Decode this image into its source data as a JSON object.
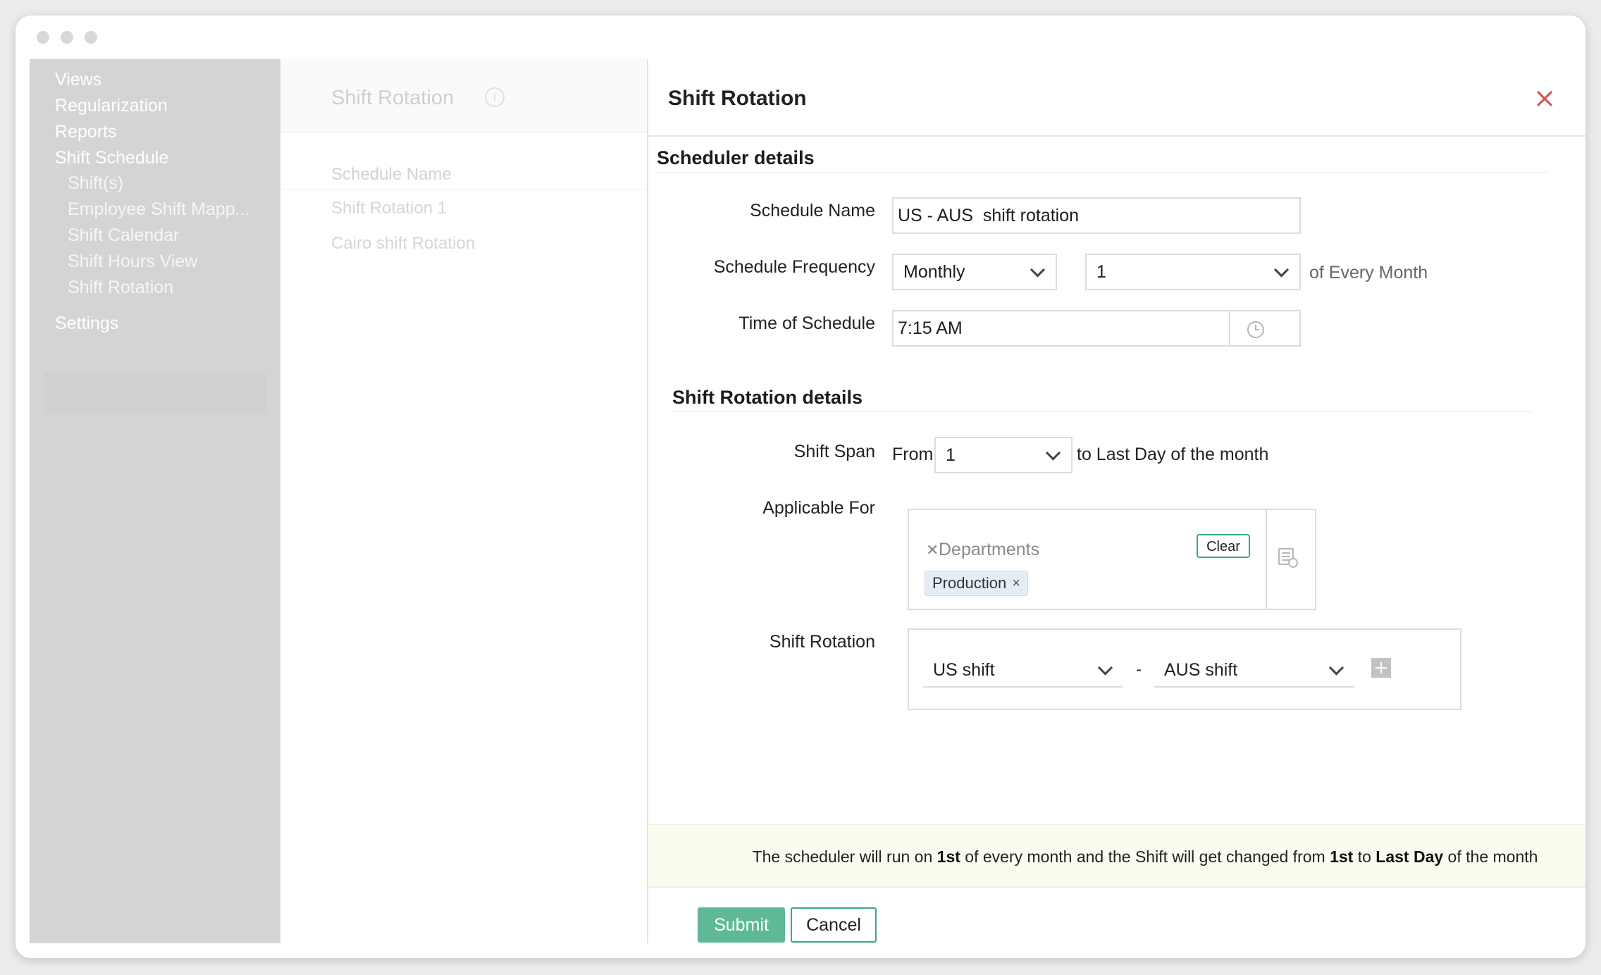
{
  "sidebar": {
    "items": [
      {
        "label": "Views"
      },
      {
        "label": "Regularization"
      },
      {
        "label": "Reports"
      },
      {
        "label": "Shift Schedule"
      },
      {
        "label": "Shift(s)"
      },
      {
        "label": "Employee Shift Mapp..."
      },
      {
        "label": "Shift Calendar"
      },
      {
        "label": "Shift Hours View"
      },
      {
        "label": "Shift Rotation"
      },
      {
        "label": "Settings"
      }
    ]
  },
  "list_panel": {
    "title": "Shift Rotation",
    "column_header": "Schedule Name",
    "rows": [
      "Shift Rotation 1",
      "Cairo shift Rotation"
    ]
  },
  "dialog": {
    "title": "Shift Rotation",
    "scheduler_section": "Scheduler details",
    "schedule_name_label": "Schedule Name",
    "schedule_name_value": "US - AUS  shift rotation",
    "frequency_label": "Schedule Frequency",
    "frequency_value": "Monthly",
    "frequency_day_value": "1",
    "frequency_suffix": "of Every Month",
    "time_label": "Time of Schedule",
    "time_value": "7:15 AM",
    "rotation_section": "Shift Rotation details",
    "span_label": "Shift Span",
    "span_from": "From",
    "span_from_value": "1",
    "span_to": "to Last Day of the month",
    "applicable_label": "Applicable For",
    "applicable_category": "Departments",
    "clear_label": "Clear",
    "applicable_tags": [
      "Production"
    ],
    "rotation_label": "Shift Rotation",
    "rotation_first": "US shift",
    "rotation_dash": "-",
    "rotation_second": "AUS shift",
    "info": {
      "p1": "The scheduler will run on ",
      "b1": "1st",
      "p2": " of every month and the Shift will get changed from ",
      "b2": "1st",
      "p3": " to ",
      "b3": "Last Day",
      "p4": " of the month"
    },
    "submit_label": "Submit",
    "cancel_label": "Cancel"
  },
  "colors": {
    "accent": "#5fb997",
    "close": "#d9534f",
    "sidebar_bg": "#d3d4d6"
  }
}
